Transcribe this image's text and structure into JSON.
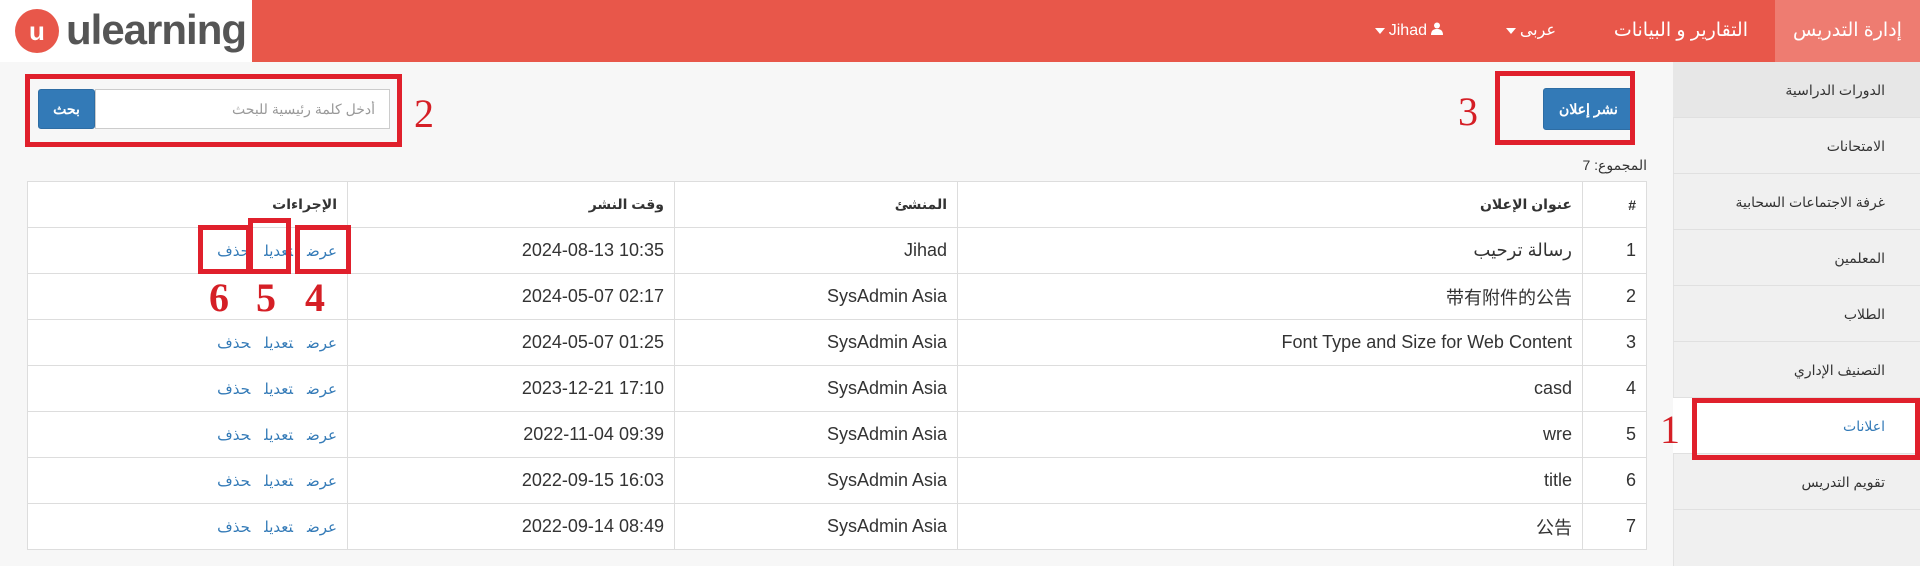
{
  "brand": {
    "logo_glyph": "u",
    "name": "ulearning"
  },
  "topnav": {
    "active": "إدارة التدريس",
    "reports": "التقارير و البيانات",
    "language": "عربى",
    "user": "Jihad"
  },
  "sidebar": {
    "items": [
      {
        "label": "الدورات الدراسية"
      },
      {
        "label": "الامتحانات"
      },
      {
        "label": "غرفة الاجتماعات السحابية"
      },
      {
        "label": "المعلمين"
      },
      {
        "label": "الطلاب"
      },
      {
        "label": "التصنيف الإداري"
      },
      {
        "label": "اعلانات"
      },
      {
        "label": "تقويم التدريس"
      }
    ]
  },
  "search": {
    "placeholder": "أدخل كلمة رئيسية للبحث",
    "button": "بحث"
  },
  "publish_button": "نشر إعلان",
  "total_label": "المجموع: 7",
  "table": {
    "headers": {
      "num": "#",
      "title": "عنوان الإعلان",
      "creator": "المنشئ",
      "time": "وقت النشر",
      "actions": "الإجراءات"
    },
    "action_labels": {
      "view": "عرض",
      "edit": "تعديل",
      "delete": "حذف"
    },
    "rows": [
      {
        "num": "1",
        "title": "رسالة ترحيب",
        "creator": "Jihad",
        "time": "2024-08-13 10:35"
      },
      {
        "num": "2",
        "title": "带有附件的公告",
        "creator": "SysAdmin Asia",
        "time": "2024-05-07 02:17"
      },
      {
        "num": "3",
        "title": "Font Type and Size for Web Content",
        "creator": "SysAdmin Asia",
        "time": "2024-05-07 01:25"
      },
      {
        "num": "4",
        "title": "casd",
        "creator": "SysAdmin Asia",
        "time": "2023-12-21 17:10"
      },
      {
        "num": "5",
        "title": "wre",
        "creator": "SysAdmin Asia",
        "time": "2022-11-04 09:39"
      },
      {
        "num": "6",
        "title": "title",
        "creator": "SysAdmin Asia",
        "time": "2022-09-15 16:03"
      },
      {
        "num": "7",
        "title": "公告",
        "creator": "SysAdmin Asia",
        "time": "2022-09-14 08:49"
      }
    ]
  },
  "annotations": [
    "1",
    "2",
    "3",
    "4",
    "5",
    "6"
  ],
  "colors": {
    "brand_red": "#e8574a",
    "button_blue": "#337ab7",
    "annotation_red": "#e0202c"
  }
}
